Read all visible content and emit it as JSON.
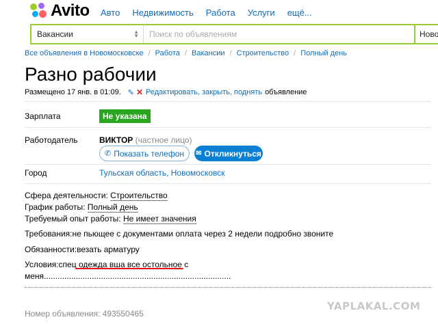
{
  "header": {
    "logo_text": "Avito",
    "nav": [
      "Авто",
      "Недвижимость",
      "Работа",
      "Услуги",
      "ещё..."
    ]
  },
  "search": {
    "category": "Вакансии",
    "placeholder": "Поиск по объявлениям",
    "city": "Ново"
  },
  "breadcrumb": [
    "Все объявления в Новомосковске",
    "Работа",
    "Вакансии",
    "Строительство",
    "Полный день"
  ],
  "listing": {
    "title": "Разно рабочии",
    "posted": "Размещено 17 янв. в 01:09.",
    "edit_link": "Редактировать, закрыть, поднять",
    "edit_suffix": "объявление"
  },
  "salary": {
    "label": "Зарплата",
    "value": "Не указана",
    "badge_color": "#2aa520"
  },
  "employer": {
    "label": "Работодатель",
    "name": "ВИКТОР",
    "kind": "(частное лицо)",
    "phone_button": "Показать телефон",
    "reply_button": "Откликнуться"
  },
  "city": {
    "label": "Город",
    "value": "Тульская область, Новомосковск"
  },
  "params": [
    {
      "label": "Сфера деятельности:",
      "value": "Строительство"
    },
    {
      "label": "График работы:",
      "value": "Полный день"
    },
    {
      "label": "Требуемый опыт работы:",
      "value": "Не имеет значения"
    }
  ],
  "description": {
    "requirements": "Требования:не пьющее с документами оплата через 2 недели подробно звоните",
    "duties": "Обязанности:везать арматуру",
    "conditions_prefix": "Условия:спец",
    "conditions_underlined": "одежда вша все остольное с",
    "conditions_line2": "меня.................................................................................."
  },
  "ad_number": "Номер объявления: 493550465",
  "watermark": "YAPLAKAL.COM"
}
